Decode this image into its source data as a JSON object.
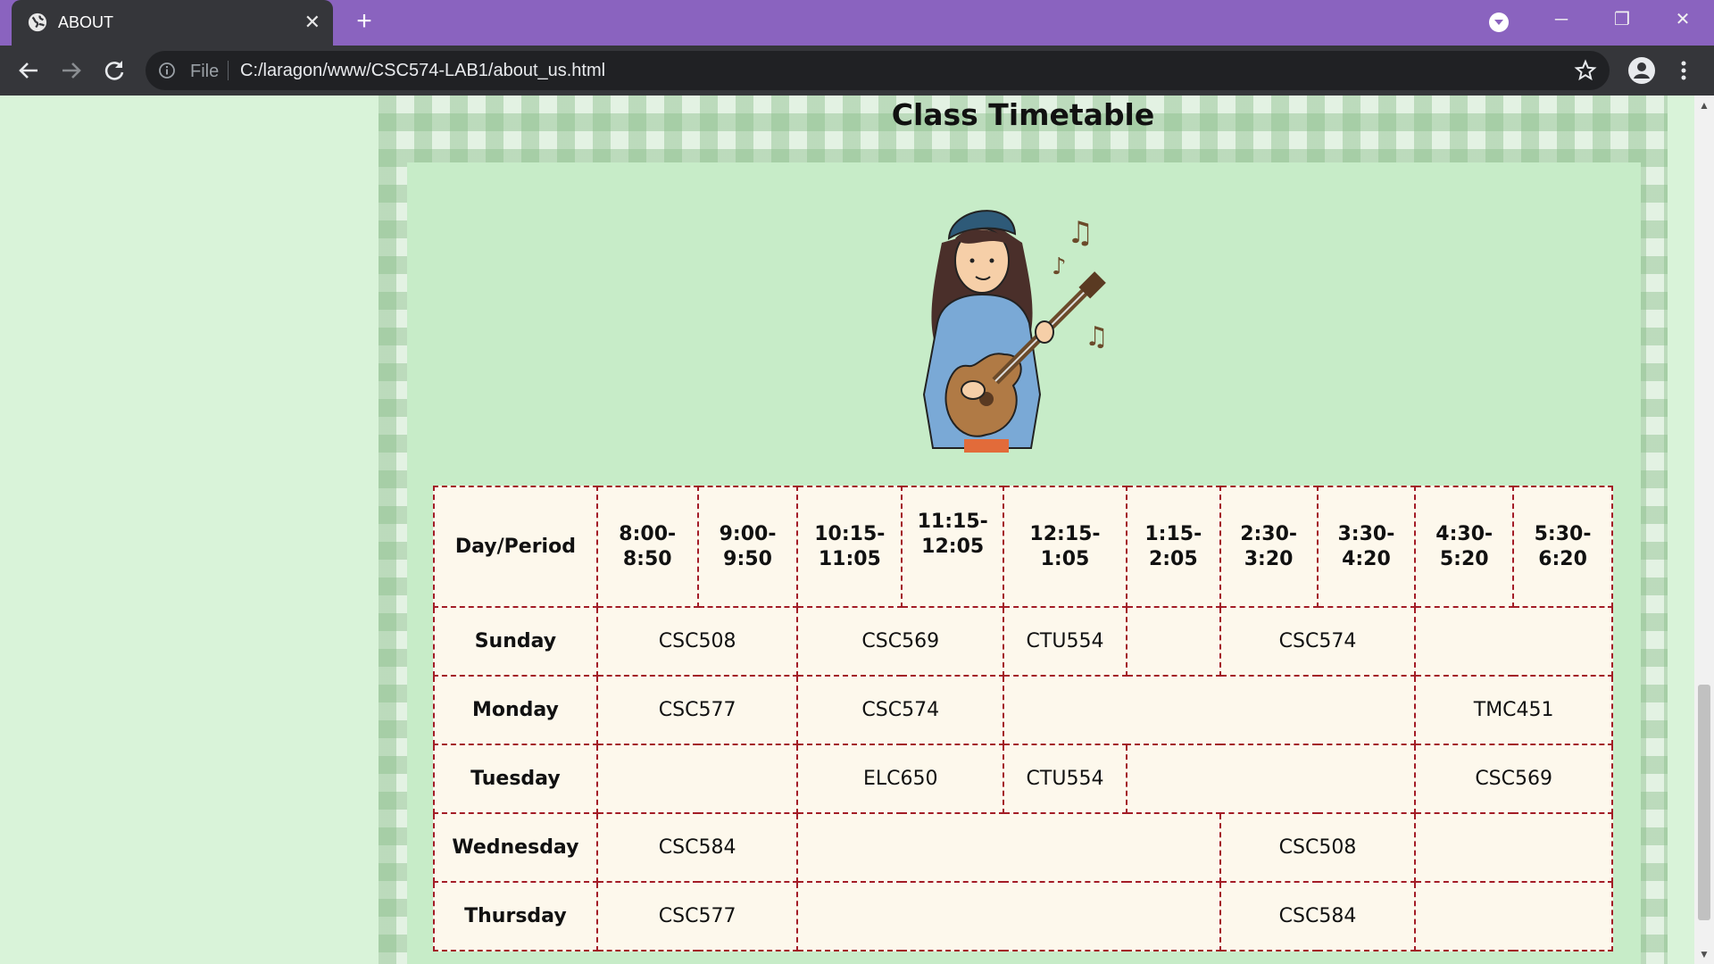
{
  "browser": {
    "tab_title": "ABOUT",
    "tab_close": "✕",
    "new_tab": "+",
    "window_controls": {
      "minimize": "─",
      "restore": "❐",
      "close": "✕"
    },
    "scheme_label": "File",
    "url": "C:/laragon/www/CSC574-LAB1/about_us.html"
  },
  "page": {
    "heading": "Class Timetable",
    "illustration_icon": "girl-playing-ukulele-illustration"
  },
  "timetable": {
    "header": {
      "day_period": "Day/Period",
      "p1_a": "8:00-",
      "p1_b": "8:50",
      "p2_a": "9:00-",
      "p2_b": "9:50",
      "p3_a": "10:15-",
      "p3_b": "11:05",
      "p4_a": "11:15-",
      "p4_b": "12:05",
      "p5_a": "12:15-",
      "p5_b": "1:05",
      "p6_a": "1:15-",
      "p6_b": "2:05",
      "p7_a": "2:30-",
      "p7_b": "3:20",
      "p8_a": "3:30-",
      "p8_b": "4:20",
      "p9_a": "4:30-",
      "p9_b": "5:20",
      "p10_a": "5:30-",
      "p10_b": "6:20"
    },
    "sunday": {
      "day": "Sunday",
      "c1": "CSC508",
      "c2": "CSC569",
      "c3": "CTU554",
      "c4": "",
      "c5": "CSC574",
      "c6": ""
    },
    "monday": {
      "day": "Monday",
      "c1": "CSC577",
      "c2": "CSC574",
      "c3": "",
      "c4": "TMC451"
    },
    "tuesday": {
      "day": "Tuesday",
      "c1": "",
      "c2": "ELC650",
      "c3": "CTU554",
      "c4": "",
      "c5": "CSC569"
    },
    "wednesday": {
      "day": "Wednesday",
      "c1": "CSC584",
      "c2": "",
      "c3": "CSC508",
      "c4": ""
    },
    "thursday": {
      "day": "Thursday",
      "c1": "CSC577",
      "c2": "",
      "c3": "CSC584",
      "c4": ""
    }
  }
}
